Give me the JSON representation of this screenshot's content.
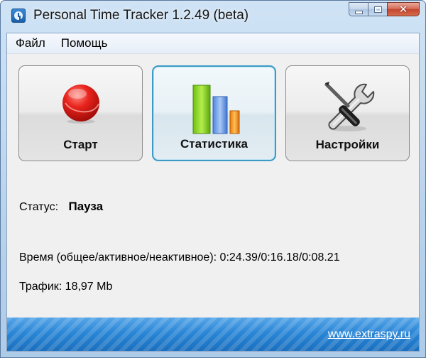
{
  "window": {
    "title": "Personal Time Tracker 1.2.49 (beta)",
    "icon": "stopwatch-icon"
  },
  "menu": {
    "items": [
      "Файл",
      "Помощь"
    ]
  },
  "toolbar": {
    "start_label": "Старт",
    "stats_label": "Статистика",
    "settings_label": "Настройки",
    "icons": [
      "record-icon",
      "bar-chart-icon",
      "tools-icon"
    ]
  },
  "status": {
    "label": "Статус:",
    "value": "Пауза"
  },
  "time": {
    "text": "Время (общее/активное/неактивное): 0:24.39/0:16.18/0:08.21"
  },
  "traffic": {
    "text": "Трафик: 18,97 Mb"
  },
  "footer": {
    "link": "www.extraspy.ru"
  },
  "colors": {
    "accent": "#3c9bc6",
    "footer_blue": "#2a86d6",
    "record_red": "#d91a16"
  }
}
